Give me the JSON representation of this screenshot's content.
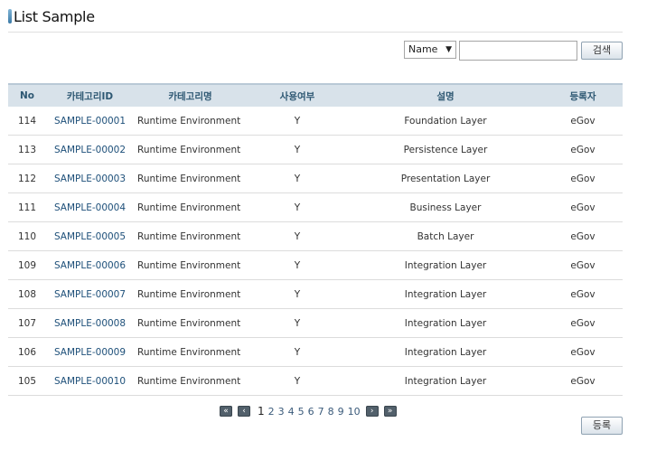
{
  "header": {
    "title": "List Sample"
  },
  "search": {
    "condition_selected": "Name",
    "condition_arrow": "▼",
    "input_value": "",
    "button_label": "검색"
  },
  "table": {
    "columns": [
      "No",
      "카테고리ID",
      "카테고리명",
      "사용여부",
      "설명",
      "등록자"
    ],
    "rows": [
      {
        "no": "114",
        "id": "SAMPLE-00001",
        "name": "Runtime Environment",
        "use": "Y",
        "desc": "Foundation Layer",
        "user": "eGov"
      },
      {
        "no": "113",
        "id": "SAMPLE-00002",
        "name": "Runtime Environment",
        "use": "Y",
        "desc": "Persistence Layer",
        "user": "eGov"
      },
      {
        "no": "112",
        "id": "SAMPLE-00003",
        "name": "Runtime Environment",
        "use": "Y",
        "desc": "Presentation Layer",
        "user": "eGov"
      },
      {
        "no": "111",
        "id": "SAMPLE-00004",
        "name": "Runtime Environment",
        "use": "Y",
        "desc": "Business Layer",
        "user": "eGov"
      },
      {
        "no": "110",
        "id": "SAMPLE-00005",
        "name": "Runtime Environment",
        "use": "Y",
        "desc": "Batch Layer",
        "user": "eGov"
      },
      {
        "no": "109",
        "id": "SAMPLE-00006",
        "name": "Runtime Environment",
        "use": "Y",
        "desc": "Integration Layer",
        "user": "eGov"
      },
      {
        "no": "108",
        "id": "SAMPLE-00007",
        "name": "Runtime Environment",
        "use": "Y",
        "desc": "Integration Layer",
        "user": "eGov"
      },
      {
        "no": "107",
        "id": "SAMPLE-00008",
        "name": "Runtime Environment",
        "use": "Y",
        "desc": "Integration Layer",
        "user": "eGov"
      },
      {
        "no": "106",
        "id": "SAMPLE-00009",
        "name": "Runtime Environment",
        "use": "Y",
        "desc": "Integration Layer",
        "user": "eGov"
      },
      {
        "no": "105",
        "id": "SAMPLE-00010",
        "name": "Runtime Environment",
        "use": "Y",
        "desc": "Integration Layer",
        "user": "eGov"
      }
    ]
  },
  "pagination": {
    "first_icon": "double-chevron-left-icon",
    "prev_icon": "chevron-left-icon",
    "next_icon": "chevron-right-icon",
    "last_icon": "double-chevron-right-icon",
    "first_glyph": "«",
    "prev_glyph": "‹",
    "next_glyph": "›",
    "last_glyph": "»",
    "current": "1",
    "pages": [
      "1",
      "2",
      "3",
      "4",
      "5",
      "6",
      "7",
      "8",
      "9",
      "10"
    ]
  },
  "footer": {
    "register_label": "등록"
  },
  "colors": {
    "header_bg": "#d8e2ea",
    "header_text": "#2e5873",
    "link_text": "#1d4f79",
    "pager_btn": "#52606b"
  }
}
